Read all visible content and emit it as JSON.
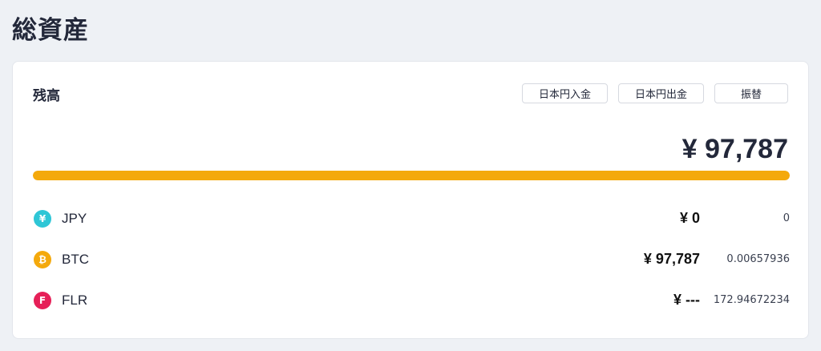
{
  "page": {
    "title": "総資産"
  },
  "balance": {
    "title": "残高",
    "actions": {
      "deposit_label": "日本円入金",
      "withdraw_label": "日本円出金",
      "transfer_label": "振替"
    },
    "total": "¥ 97,787",
    "allocation_bar": {
      "fraction": 1.0,
      "color": "#f4a90c"
    },
    "assets": [
      {
        "icon": "yen-icon",
        "icon_glyph": "¥",
        "icon_color": "#2ec6d6",
        "symbol": "JPY",
        "jpy_value": "¥ 0",
        "amount": "0"
      },
      {
        "icon": "bitcoin-icon",
        "icon_glyph": "₿",
        "icon_color": "#f4a90c",
        "symbol": "BTC",
        "jpy_value": "¥ 97,787",
        "amount": "0.00657936"
      },
      {
        "icon": "flare-icon",
        "icon_glyph": "F",
        "icon_color": "#e62058",
        "symbol": "FLR",
        "jpy_value": "¥ ---",
        "amount": "172.94672234"
      }
    ]
  }
}
